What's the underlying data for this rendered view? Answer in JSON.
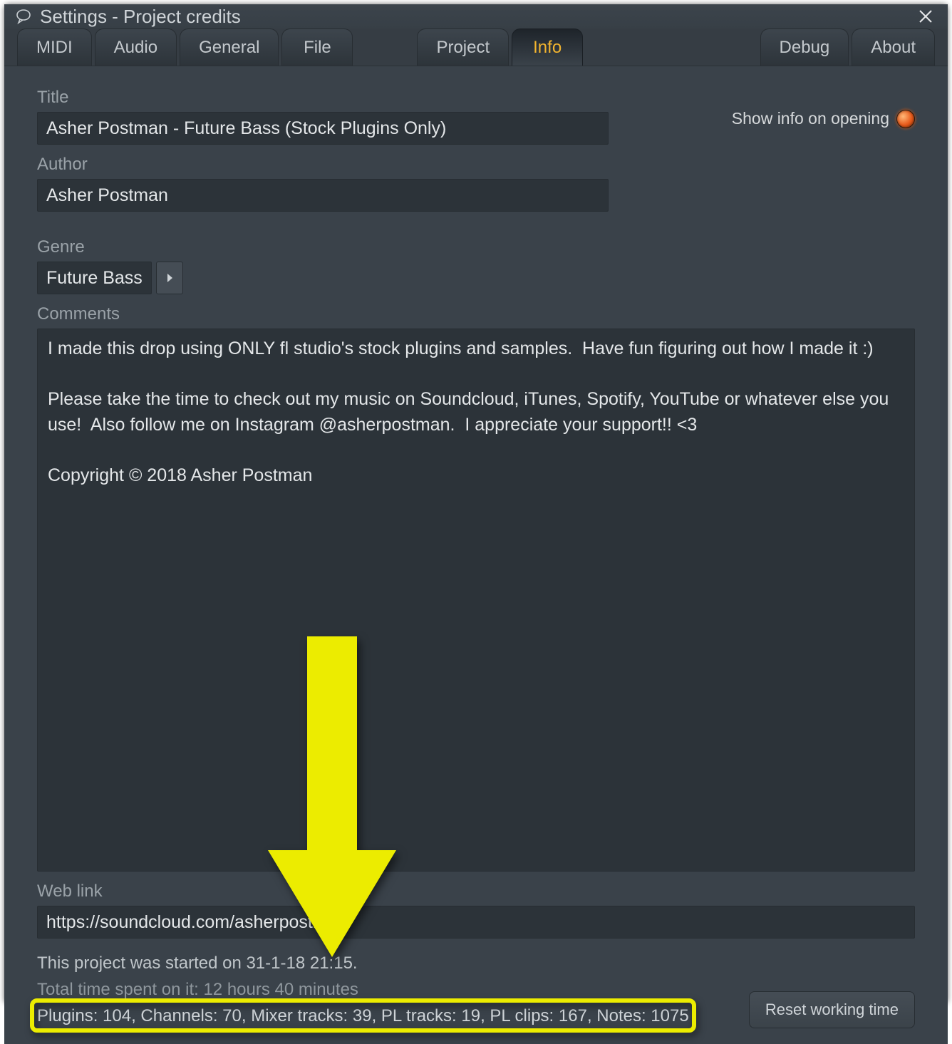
{
  "window": {
    "title": "Settings - Project credits"
  },
  "tabs": {
    "group1": [
      "MIDI",
      "Audio",
      "General",
      "File"
    ],
    "group2": [
      "Project",
      "Info"
    ],
    "group3": [
      "Debug",
      "About"
    ],
    "active": "Info"
  },
  "fields": {
    "title_label": "Title",
    "title_value": "Asher Postman - Future Bass (Stock Plugins Only)",
    "showinfo_label": "Show info on opening",
    "author_label": "Author",
    "author_value": "Asher Postman",
    "genre_label": "Genre",
    "genre_value": "Future Bass",
    "comments_label": "Comments",
    "comments_value": "I made this drop using ONLY fl studio's stock plugins and samples.  Have fun figuring out how I made it :)\n\nPlease take the time to check out my music on Soundcloud, iTunes, Spotify, YouTube or whatever else you use!  Also follow me on Instagram @asherpostman.  I appreciate your support!! <3\n\nCopyright © 2018 Asher Postman",
    "weblink_label": "Web link",
    "weblink_value": "https://soundcloud.com/asherpostman"
  },
  "footer": {
    "started": "This project was started on 31-1-18 21:15.",
    "timespent": "Total time spent on it: 12 hours 40 minutes",
    "stats": "Plugins: 104, Channels: 70, Mixer tracks: 39, PL tracks: 19, PL clips: 167, Notes: 1075",
    "reset_label": "Reset working time"
  },
  "colors": {
    "accent": "#f2b42f",
    "highlight": "#ecec00"
  }
}
